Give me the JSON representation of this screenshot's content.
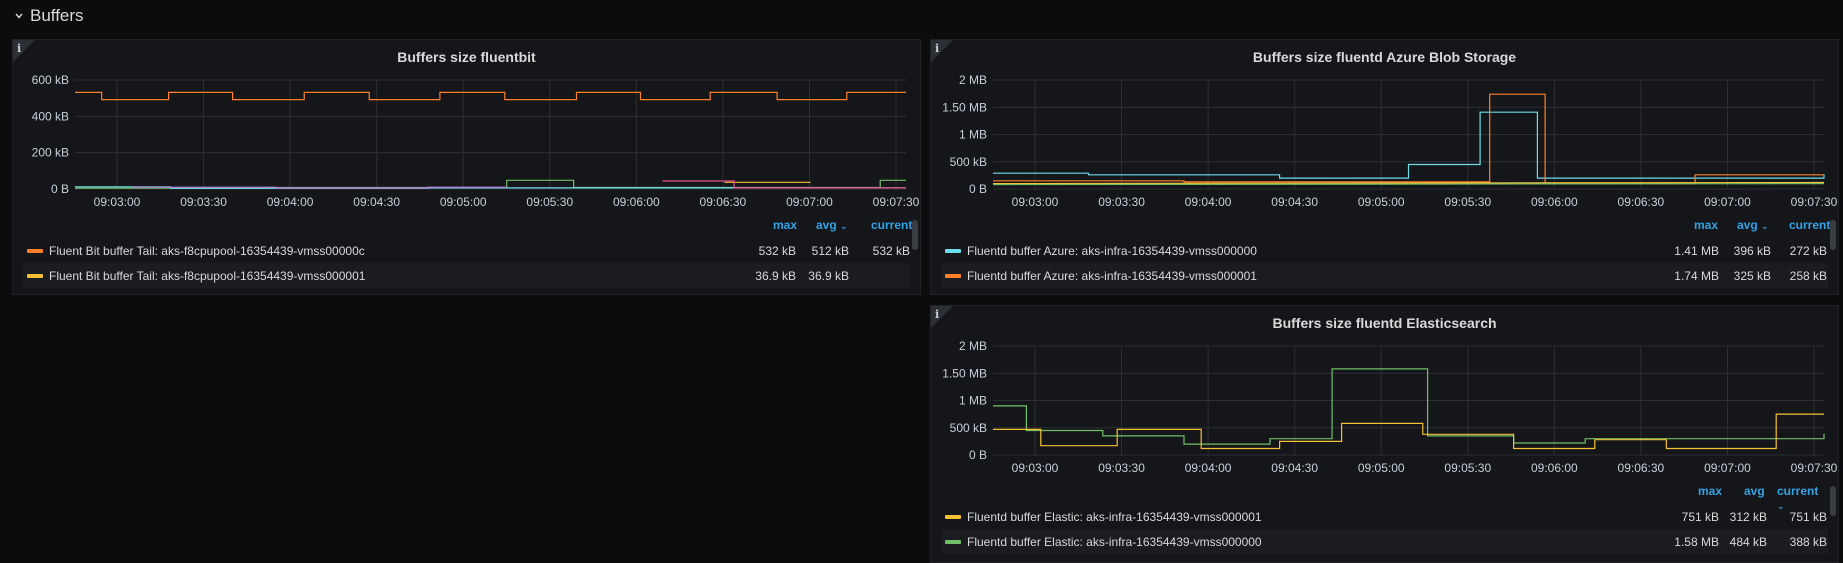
{
  "row": {
    "title": "Buffers"
  },
  "sortIndicator": "⌄",
  "colors": {
    "orange": "#ff7f2a",
    "yellow": "#f5c034",
    "cyan": "#6fdcec",
    "green": "#73bf69",
    "purple": "#b877d9",
    "pink": "#e8528e",
    "blue": "#5794f2"
  },
  "panels": [
    {
      "id": "fluentbit",
      "title": "Buffers size fluentbit",
      "legend": {
        "headers": {
          "max": "max",
          "avg": "avg",
          "current": "current"
        },
        "rows": [
          {
            "name": "Fluent Bit buffer Tail: aks-f8cpupool-16354439-vmss00000c",
            "color": "#ff7f2a",
            "max": "532 kB",
            "avg": "512 kB",
            "current": "532 kB"
          },
          {
            "name": "Fluent Bit buffer Tail: aks-f8cpupool-16354439-vmss000001",
            "color": "#f5c034",
            "max": "36.9 kB",
            "avg": "36.9 kB",
            "current": ""
          }
        ]
      },
      "chart_data": {
        "type": "line",
        "title": "Buffers size fluentbit",
        "x": [
          "09:03:00",
          "09:03:30",
          "09:04:00",
          "09:04:30",
          "09:05:00",
          "09:05:30",
          "09:06:00",
          "09:06:30",
          "09:07:00",
          "09:07:30"
        ],
        "yticks": [
          "0 B",
          "200 kB",
          "400 kB",
          "600 kB"
        ],
        "ylim": [
          0,
          600
        ],
        "yunit": "kB",
        "xlim": [
          "09:02:40",
          "09:07:40"
        ],
        "grid": true,
        "series": [
          {
            "name": "Fluent Bit buffer Tail: aks-f8cpupool-16354439-vmss00000c",
            "color": "#ff7f2a",
            "points": [
              [
                0,
                532
              ],
              [
                28,
                532
              ],
              [
                28,
                492
              ],
              [
                98,
                492
              ],
              [
                98,
                532
              ],
              [
                165,
                532
              ],
              [
                165,
                492
              ],
              [
                240,
                492
              ],
              [
                240,
                532
              ],
              [
                308,
                532
              ],
              [
                308,
                492
              ],
              [
                382,
                492
              ],
              [
                382,
                532
              ],
              [
                450,
                532
              ],
              [
                450,
                492
              ],
              [
                525,
                492
              ],
              [
                525,
                532
              ],
              [
                592,
                532
              ],
              [
                592,
                492
              ],
              [
                665,
                492
              ],
              [
                665,
                532
              ],
              [
                735,
                532
              ],
              [
                735,
                492
              ],
              [
                808,
                492
              ],
              [
                808,
                532
              ],
              [
                870,
                532
              ]
            ]
          },
          {
            "name": "green",
            "color": "#73bf69",
            "points": [
              [
                0,
                5
              ],
              [
                200,
                5
              ],
              [
                200,
                8
              ],
              [
                452,
                8
              ],
              [
                452,
                48
              ],
              [
                522,
                48
              ],
              [
                522,
                8
              ],
              [
                843,
                8
              ],
              [
                843,
                48
              ],
              [
                870,
                48
              ]
            ]
          },
          {
            "name": "cyan",
            "color": "#6fdcec",
            "points": [
              [
                0,
                12
              ],
              [
                100,
                12
              ],
              [
                100,
                4
              ],
              [
                370,
                4
              ],
              [
                370,
                6
              ],
              [
                870,
                6
              ]
            ]
          },
          {
            "name": "purple",
            "color": "#b877d9",
            "points": [
              [
                60,
                10
              ],
              [
                210,
                10
              ],
              [
                210,
                6
              ],
              [
                370,
                6
              ],
              [
                370,
                10
              ],
              [
                452,
                10
              ]
            ]
          },
          {
            "name": "Fluent Bit buffer Tail: aks-f8cpupool-16354439-vmss000001",
            "color": "#f5c034",
            "points": [
              [
                680,
                36.9
              ],
              [
                770,
                36.9
              ]
            ]
          },
          {
            "name": "pink",
            "color": "#e8528e",
            "points": [
              [
                615,
                44
              ],
              [
                690,
                44
              ],
              [
                690,
                6
              ],
              [
                870,
                6
              ]
            ]
          }
        ]
      }
    },
    {
      "id": "azure",
      "title": "Buffers size fluentd Azure Blob Storage",
      "legend": {
        "headers": {
          "max": "max",
          "avg": "avg",
          "current": "current"
        },
        "rows": [
          {
            "name": "Fluentd buffer Azure: aks-infra-16354439-vmss000000",
            "color": "#6fdcec",
            "max": "1.41 MB",
            "avg": "396 kB",
            "current": "272 kB"
          },
          {
            "name": "Fluentd buffer Azure: aks-infra-16354439-vmss000001",
            "color": "#ff7f2a",
            "max": "1.74 MB",
            "avg": "325 kB",
            "current": "258 kB"
          }
        ]
      },
      "chart_data": {
        "type": "line",
        "title": "Buffers size fluentd Azure Blob Storage",
        "x": [
          "09:03:00",
          "09:03:30",
          "09:04:00",
          "09:04:30",
          "09:05:00",
          "09:05:30",
          "09:06:00",
          "09:06:30",
          "09:07:00",
          "09:07:30"
        ],
        "yticks": [
          "0 B",
          "500 kB",
          "1 MB",
          "1.50 MB",
          "2 MB"
        ],
        "ylim": [
          0,
          2
        ],
        "yunit": "MB",
        "grid": true,
        "series": [
          {
            "name": "Fluentd buffer Azure: aks-infra-16354439-vmss000000",
            "color": "#6fdcec",
            "points": [
              [
                0,
                0.29
              ],
              [
                100,
                0.29
              ],
              [
                100,
                0.26
              ],
              [
                300,
                0.26
              ],
              [
                300,
                0.2
              ],
              [
                435,
                0.2
              ],
              [
                435,
                0.45
              ],
              [
                510,
                0.45
              ],
              [
                510,
                1.41
              ],
              [
                570,
                1.41
              ],
              [
                570,
                0.2
              ],
              [
                870,
                0.2
              ],
              [
                870,
                0.27
              ]
            ]
          },
          {
            "name": "Fluentd buffer Azure: aks-infra-16354439-vmss000001",
            "color": "#ff7f2a",
            "points": [
              [
                0,
                0.15
              ],
              [
                200,
                0.15
              ],
              [
                200,
                0.13
              ],
              [
                520,
                0.13
              ],
              [
                520,
                1.74
              ],
              [
                578,
                1.74
              ],
              [
                578,
                0.1
              ],
              [
                735,
                0.1
              ],
              [
                735,
                0.26
              ],
              [
                870,
                0.26
              ]
            ]
          },
          {
            "name": "yellow",
            "color": "#f5c034",
            "points": [
              [
                0,
                0.1
              ],
              [
                870,
                0.12
              ]
            ]
          },
          {
            "name": "green",
            "color": "#73bf69",
            "points": [
              [
                0,
                0.08
              ],
              [
                870,
                0.1
              ]
            ]
          }
        ]
      }
    },
    {
      "id": "elastic",
      "title": "Buffers size fluentd Elasticsearch",
      "legend": {
        "headers": {
          "max": "max",
          "avg": "avg",
          "current": "current"
        },
        "rows": [
          {
            "name": "Fluentd buffer Elastic: aks-infra-16354439-vmss000001",
            "color": "#f5c034",
            "max": "751 kB",
            "avg": "312 kB",
            "current": "751 kB"
          },
          {
            "name": "Fluentd buffer Elastic: aks-infra-16354439-vmss000000",
            "color": "#73bf69",
            "max": "1.58 MB",
            "avg": "484 kB",
            "current": "388 kB"
          }
        ]
      },
      "chart_data": {
        "type": "line",
        "title": "Buffers size fluentd Elasticsearch",
        "x": [
          "09:03:00",
          "09:03:30",
          "09:04:00",
          "09:04:30",
          "09:05:00",
          "09:05:30",
          "09:06:00",
          "09:06:30",
          "09:07:00",
          "09:07:30"
        ],
        "yticks": [
          "0 B",
          "500 kB",
          "1 MB",
          "1.50 MB",
          "2 MB"
        ],
        "ylim": [
          0,
          2
        ],
        "yunit": "MB",
        "grid": true,
        "series": [
          {
            "name": "Fluentd buffer Elastic: aks-infra-16354439-vmss000000",
            "color": "#73bf69",
            "points": [
              [
                0,
                0.9
              ],
              [
                35,
                0.9
              ],
              [
                35,
                0.45
              ],
              [
                115,
                0.45
              ],
              [
                115,
                0.35
              ],
              [
                200,
                0.35
              ],
              [
                200,
                0.2
              ],
              [
                290,
                0.2
              ],
              [
                290,
                0.3
              ],
              [
                355,
                0.3
              ],
              [
                355,
                1.58
              ],
              [
                455,
                1.58
              ],
              [
                455,
                0.35
              ],
              [
                545,
                0.35
              ],
              [
                545,
                0.22
              ],
              [
                620,
                0.22
              ],
              [
                620,
                0.3
              ],
              [
                870,
                0.3
              ],
              [
                870,
                0.39
              ]
            ]
          },
          {
            "name": "Fluentd buffer Elastic: aks-infra-16354439-vmss000001",
            "color": "#f5c034",
            "points": [
              [
                0,
                0.47
              ],
              [
                50,
                0.47
              ],
              [
                50,
                0.17
              ],
              [
                130,
                0.17
              ],
              [
                130,
                0.47
              ],
              [
                218,
                0.47
              ],
              [
                218,
                0.12
              ],
              [
                300,
                0.12
              ],
              [
                300,
                0.25
              ],
              [
                365,
                0.25
              ],
              [
                365,
                0.58
              ],
              [
                450,
                0.58
              ],
              [
                450,
                0.38
              ],
              [
                545,
                0.38
              ],
              [
                545,
                0.12
              ],
              [
                630,
                0.12
              ],
              [
                630,
                0.28
              ],
              [
                705,
                0.28
              ],
              [
                705,
                0.12
              ],
              [
                820,
                0.12
              ],
              [
                820,
                0.75
              ],
              [
                870,
                0.75
              ]
            ]
          }
        ]
      }
    }
  ]
}
